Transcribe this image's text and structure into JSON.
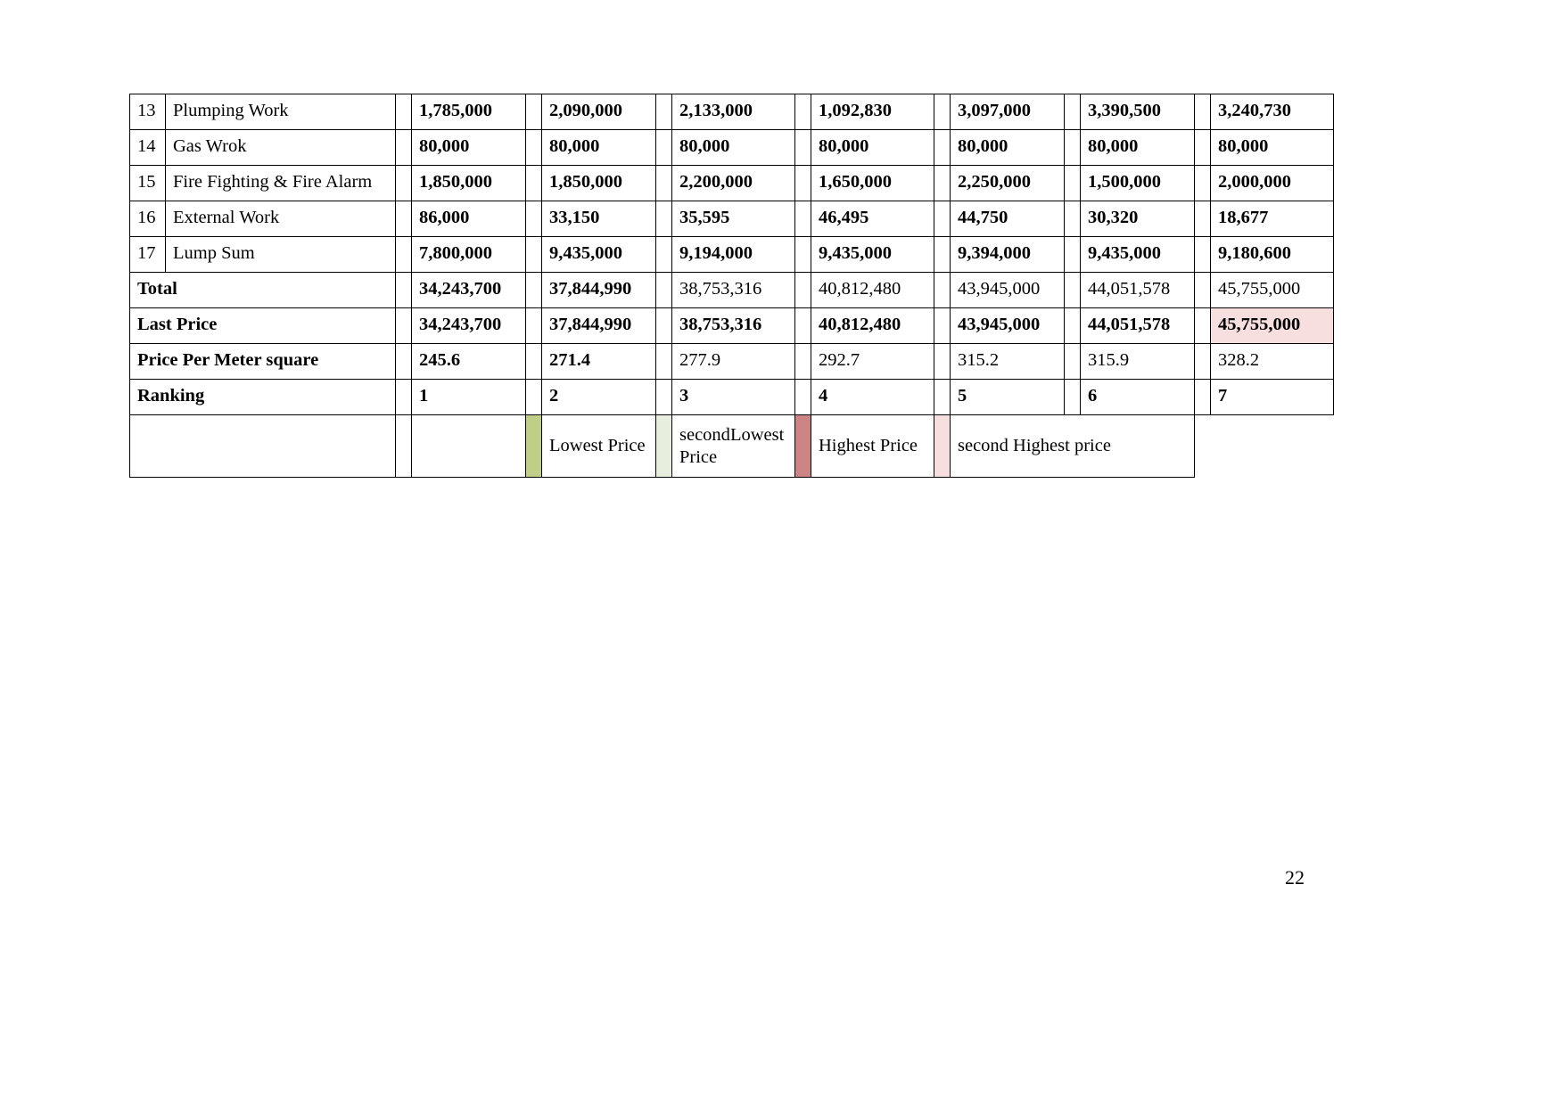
{
  "document": {
    "page_number": "22",
    "table_name": "bid-comparison-table"
  },
  "columns": {
    "index_header": "",
    "description_header": "",
    "bidder_count": 7
  },
  "rows": [
    {
      "index": "13",
      "description": "Plumping Work",
      "values": [
        "1,785,000",
        "2,090,000",
        "2,133,000",
        "1,092,830",
        "3,097,000",
        "3,390,500",
        "3,240,730"
      ],
      "bold": true
    },
    {
      "index": "14",
      "description": "Gas Wrok",
      "values": [
        "80,000",
        "80,000",
        "80,000",
        "80,000",
        "80,000",
        "80,000",
        "80,000"
      ],
      "bold": true
    },
    {
      "index": "15",
      "description": "Fire Fighting & Fire Alarm",
      "values": [
        "1,850,000",
        "1,850,000",
        "2,200,000",
        "1,650,000",
        "2,250,000",
        "1,500,000",
        "2,000,000"
      ],
      "bold": true
    },
    {
      "index": "16",
      "description": "External Work",
      "values": [
        "86,000",
        "33,150",
        "35,595",
        "46,495",
        "44,750",
        "30,320",
        "18,677"
      ],
      "bold": true
    },
    {
      "index": "17",
      "description": "Lump Sum",
      "values": [
        "7,800,000",
        "9,435,000",
        "9,194,000",
        "9,435,000",
        "9,394,000",
        "9,435,000",
        "9,180,600"
      ],
      "bold": true
    }
  ],
  "summary_rows": [
    {
      "label": "Total",
      "values": [
        "34,243,700",
        "37,844,990",
        "38,753,316",
        "40,812,480",
        "43,945,000",
        "44,051,578",
        "45,755,000"
      ],
      "bold_values": [
        true,
        true,
        false,
        false,
        false,
        false,
        false
      ]
    },
    {
      "label": "Last Price",
      "values": [
        "34,243,700",
        "37,844,990",
        "38,753,316",
        "40,812,480",
        "43,945,000",
        "44,051,578",
        "45,755,000"
      ],
      "bold_values": [
        true,
        true,
        true,
        true,
        true,
        true,
        true
      ],
      "highlight_index": 6
    },
    {
      "label": "Price Per Meter square",
      "values": [
        "245.6",
        "271.4",
        "277.9",
        "292.7",
        "315.2",
        "315.9",
        "328.2"
      ],
      "bold_values": [
        true,
        true,
        false,
        false,
        false,
        false,
        false
      ]
    },
    {
      "label": "Ranking",
      "values": [
        "1",
        "2",
        "3",
        "4",
        "5",
        "6",
        "7"
      ],
      "bold_values": [
        true,
        true,
        true,
        true,
        true,
        true,
        true
      ]
    }
  ],
  "legend": [
    {
      "swatch_color": "#bfcf87",
      "label": "Lowest Price"
    },
    {
      "swatch_color": "#e8eede",
      "label_line1": "second",
      "label_line2": "Price",
      "label_mid": "Lowest",
      "label": "second Lowest Price"
    },
    {
      "swatch_color": "#cd8484",
      "label": "Highest Price"
    },
    {
      "swatch_color": "#f7dfe0",
      "label": "second Highest price"
    }
  ],
  "colors": {
    "lowest": "#bfcf87",
    "second_lowest": "#e8eede",
    "highest": "#cd8484",
    "second_highest": "#f7dfe0",
    "border": "#000000",
    "text": "#000000"
  }
}
